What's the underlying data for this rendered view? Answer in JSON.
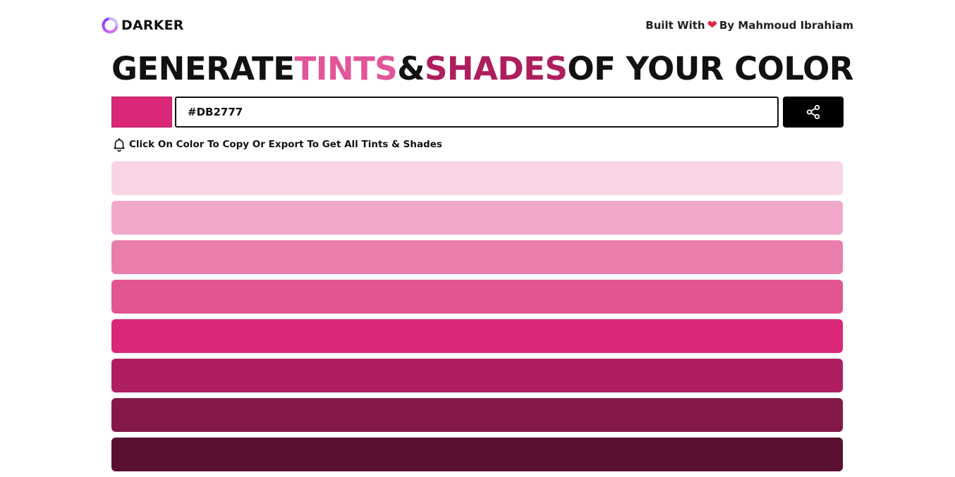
{
  "header": {
    "logo_text": "DARKER",
    "credits_prefix": "Built With",
    "credits_suffix": "By Mahmoud Ibrahiam"
  },
  "title": {
    "w1": "GENERATE",
    "w2": "TINTS",
    "w3": "&",
    "w4": "SHADES",
    "w5": "OF YOUR COLOR"
  },
  "input": {
    "value": "#DB2777"
  },
  "hint": "Click On Color To Copy Or Export To Get All Tints & Shades",
  "colors": {
    "base": "#DB2777",
    "tints_word": "#E2559A",
    "shades_word": "#AE1E5F",
    "heart": "#E0224A"
  },
  "icons": {
    "logo": "logo-ring-icon",
    "heart": "heart-icon",
    "share": "share-icon",
    "bell": "bell-icon"
  },
  "palette": [
    "#F8D4E4",
    "#F0A9CA",
    "#E97EAD",
    "#E25492",
    "#DB2777",
    "#AF1F5F",
    "#841848",
    "#5A1030"
  ]
}
